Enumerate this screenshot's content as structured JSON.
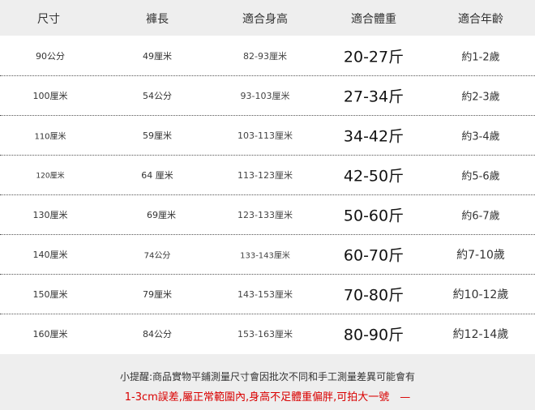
{
  "headers": [
    "尺寸",
    "褲長",
    "適合身高",
    "適合體重",
    "適合年齡"
  ],
  "rows": [
    {
      "size": "90公分",
      "length": "49厘米",
      "height": "82-93厘米",
      "weight": "20-27斤",
      "age": "約1-2歲"
    },
    {
      "size": "100厘米",
      "length": "54公分",
      "height": "93-103厘米",
      "weight": "27-34斤",
      "age": "約2-3歲"
    },
    {
      "size": "110厘米",
      "length": "59厘米",
      "height": "103-113厘米",
      "weight": "34-42斤",
      "age": "約3-4歲"
    },
    {
      "size": "120厘米",
      "length": "64 厘米",
      "height": "113-123厘米",
      "weight": "42-50斤",
      "age": "約5-6歲"
    },
    {
      "size": "130厘米",
      "length": "69厘米",
      "height": "123-133厘米",
      "weight": "50-60斤",
      "age": "約6-7歲"
    },
    {
      "size": "140厘米",
      "length": "74公分",
      "height": "133-143厘米",
      "weight": "60-70斤",
      "age": "約7-10歲"
    },
    {
      "size": "150厘米",
      "length": "79厘米",
      "height": "143-153厘米",
      "weight": "70-80斤",
      "age": "約10-12歲"
    },
    {
      "size": "160厘米",
      "length": "84公分",
      "height": "153-163厘米",
      "weight": "80-90斤",
      "age": "約12-14歲"
    }
  ],
  "note": {
    "line1": "小提醒:商品實物平鋪測量尺寸會因批次不同和手工測量差異可能會有",
    "line2": "1-3cm誤差,屬正常範圍內,身高不足體重偏胖,可拍大一號　—"
  },
  "colors": {
    "header_bg": "#eeeeee",
    "note_red": "#d90000"
  }
}
